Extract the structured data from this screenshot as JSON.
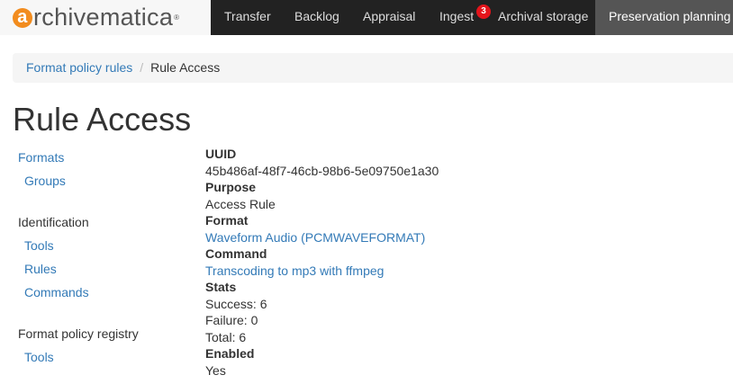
{
  "app": {
    "logo_text": "rchivematica",
    "logo_letter": "a",
    "logo_reg": "®",
    "nav": {
      "transfer": "Transfer",
      "backlog": "Backlog",
      "appraisal": "Appraisal",
      "ingest": "Ingest",
      "ingest_badge": "3",
      "archival_storage": "Archival storage",
      "preservation_planning": "Preservation planning"
    }
  },
  "breadcrumb": {
    "parent": "Format policy rules",
    "separator": "/",
    "current": "Rule Access"
  },
  "page": {
    "title": "Rule Access"
  },
  "sidebar": {
    "formats": "Formats",
    "groups": "Groups",
    "identification": "Identification",
    "tools": "Tools",
    "rules": "Rules",
    "commands": "Commands",
    "registry": "Format policy registry",
    "registry_tools": "Tools"
  },
  "details": {
    "uuid_label": "UUID",
    "uuid_value": "45b486af-48f7-46cb-98b6-5e09750e1a30",
    "purpose_label": "Purpose",
    "purpose_value": "Access Rule",
    "format_label": "Format",
    "format_value": "Waveform Audio (PCMWAVEFORMAT)",
    "command_label": "Command",
    "command_value": "Transcoding to mp3 with ffmpeg",
    "stats_label": "Stats",
    "success": "Success: 6",
    "failure": "Failure: 0",
    "total": "Total: 6",
    "enabled_label": "Enabled",
    "enabled_value": "Yes"
  },
  "colors": {
    "navbar": "#222222",
    "nav_active": "#555555",
    "link": "#337ab7",
    "badge": "#e4141b",
    "logo_accent": "#f28c1e"
  }
}
